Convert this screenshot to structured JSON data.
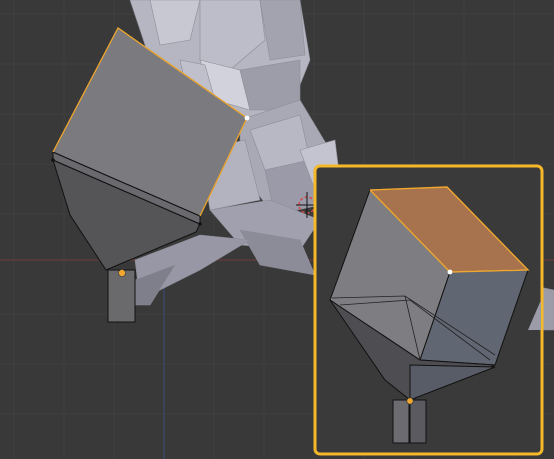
{
  "viewport": {
    "background": "#393939",
    "grid_color": "#404040",
    "x_axis_color": "#6e3a3a",
    "y_axis_color": "#3d4a6e",
    "mesh_base_color": "#a6a6b4",
    "selection_color": "#f0a830",
    "inset_frame_color": "#f4b829",
    "selected_face_color": "#a7734e",
    "cursor_color": "#d14a4a",
    "cursor_icon": "3d-cursor-icon"
  }
}
